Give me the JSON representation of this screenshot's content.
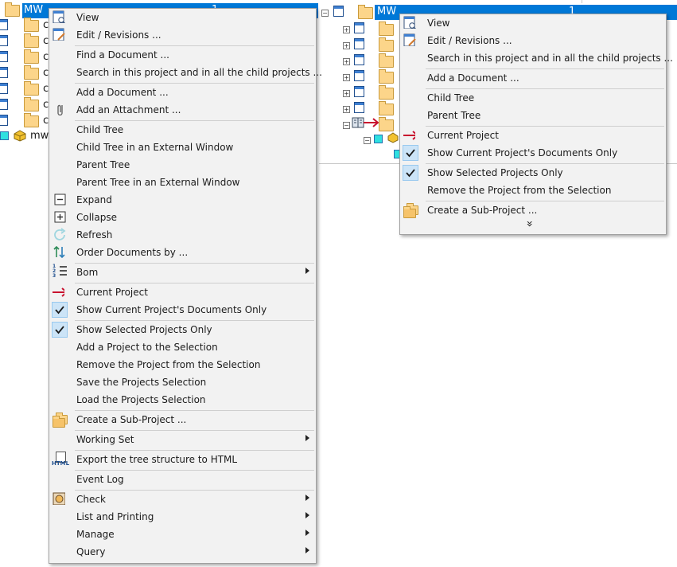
{
  "tree_left": {
    "selected_label": "MW",
    "selected_value": "1",
    "rows": [
      "c",
      "c",
      "c",
      "c",
      "c",
      "c",
      "c"
    ],
    "bottom_label": "mw_"
  },
  "tree_right": {
    "selected_label": "MW",
    "selected_value": "1"
  },
  "menu_main": {
    "items": [
      {
        "label": "View",
        "icon": "view-document-icon"
      },
      {
        "label": "Edit / Revisions ...",
        "icon": "edit-document-icon"
      },
      {
        "label": "Find a Document ..."
      },
      {
        "label": "Search in this project and in all the child projects ..."
      },
      {
        "label": "Add a Document ..."
      },
      {
        "label": "Add an Attachment ...",
        "icon": "paperclip-icon"
      },
      {
        "label": "Child Tree"
      },
      {
        "label": "Child Tree in an External Window"
      },
      {
        "label": "Parent Tree"
      },
      {
        "label": "Parent Tree in an External Window"
      },
      {
        "label": "Expand",
        "icon": "minus-box-icon"
      },
      {
        "label": "Collapse",
        "icon": "plus-box-icon"
      },
      {
        "label": "Refresh",
        "icon": "refresh-icon"
      },
      {
        "label": "Order Documents by ...",
        "icon": "sort-icon"
      },
      {
        "label": "Bom",
        "icon": "numbered-list-icon",
        "submenu": true
      },
      {
        "label": "Current Project",
        "icon": "red-arrow-icon"
      },
      {
        "label": "Show Current Project's Documents Only",
        "checked": true
      },
      {
        "label": "Show Selected Projects Only",
        "checked": true
      },
      {
        "label": "Add a Project to the Selection"
      },
      {
        "label": "Remove the Project from the Selection"
      },
      {
        "label": "Save the Projects Selection"
      },
      {
        "label": "Load the Projects Selection"
      },
      {
        "label": "Create a Sub-Project ...",
        "icon": "folders-icon"
      },
      {
        "label": "Working Set",
        "submenu": true
      },
      {
        "label": "Export the tree structure to HTML",
        "icon": "html-file-icon"
      },
      {
        "label": "Event Log"
      },
      {
        "label": "Check",
        "icon": "check-coin-icon",
        "submenu": true
      },
      {
        "label": "List and Printing",
        "submenu": true
      },
      {
        "label": "Manage",
        "submenu": true
      },
      {
        "label": "Query",
        "submenu": true
      }
    ],
    "html_icon_text": "HTML",
    "bom_icon_text": "1 2 3"
  },
  "menu_right": {
    "items": [
      {
        "label": "View",
        "icon": "view-document-icon"
      },
      {
        "label": "Edit / Revisions ...",
        "icon": "edit-document-icon"
      },
      {
        "label": "Search in this project and in all the child projects ..."
      },
      {
        "label": "Add a Document ..."
      },
      {
        "label": "Child Tree"
      },
      {
        "label": "Parent Tree"
      },
      {
        "label": "Current Project",
        "icon": "red-arrow-icon"
      },
      {
        "label": "Show Current Project's Documents Only",
        "checked": true
      },
      {
        "label": "Show Selected Projects Only",
        "checked": true
      },
      {
        "label": "Remove the Project from the Selection"
      },
      {
        "label": "Create a Sub-Project ...",
        "icon": "folders-icon"
      }
    ],
    "more_glyph": "»"
  },
  "colors": {
    "selection": "#0078d7",
    "menu_bg": "#f2f2f2",
    "check_bg": "#cce4f7",
    "arrow_red": "#c8102e",
    "folder": "#fcd58a"
  }
}
